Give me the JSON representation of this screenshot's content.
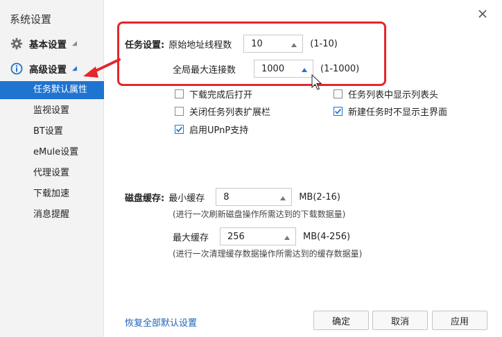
{
  "window": {
    "title": "系统设置"
  },
  "sidebar": {
    "sections": [
      {
        "label": "基本设置"
      },
      {
        "label": "高级设置"
      }
    ],
    "items": [
      {
        "label": "任务默认属性",
        "active": true
      },
      {
        "label": "监视设置"
      },
      {
        "label": "BT设置"
      },
      {
        "label": "eMule设置"
      },
      {
        "label": "代理设置"
      },
      {
        "label": "下载加速"
      },
      {
        "label": "消息提醒"
      }
    ]
  },
  "task_settings": {
    "group_label": "任务设置:",
    "thread_label": "原始地址线程数",
    "thread_value": "10",
    "thread_range": "(1-10)",
    "max_conn_label": "全局最大连接数",
    "max_conn_value": "1000",
    "max_conn_range": "(1-1000)"
  },
  "checkboxes": [
    {
      "label": "下载完成后打开",
      "checked": false
    },
    {
      "label": "任务列表中显示列表头",
      "checked": false
    },
    {
      "label": "关闭任务列表扩展栏",
      "checked": false
    },
    {
      "label": "新建任务时不显示主界面",
      "checked": true
    },
    {
      "label": "启用UPnP支持",
      "checked": true
    }
  ],
  "disk_cache": {
    "group_label": "磁盘缓存:",
    "min_label": "最小缓存",
    "min_value": "8",
    "min_unit": "MB(2-16)",
    "min_note": "(进行一次刷新磁盘操作所需达到的下载数据量)",
    "max_label": "最大缓存",
    "max_value": "256",
    "max_unit": "MB(4-256)",
    "max_note": "(进行一次清理缓存数据操作所需达到的缓存数据量)"
  },
  "footer": {
    "restore_link": "恢复全部默认设置",
    "ok": "确定",
    "cancel": "取消",
    "apply": "应用"
  },
  "colors": {
    "accent": "#1f73d1",
    "annotation": "#e5262b"
  }
}
